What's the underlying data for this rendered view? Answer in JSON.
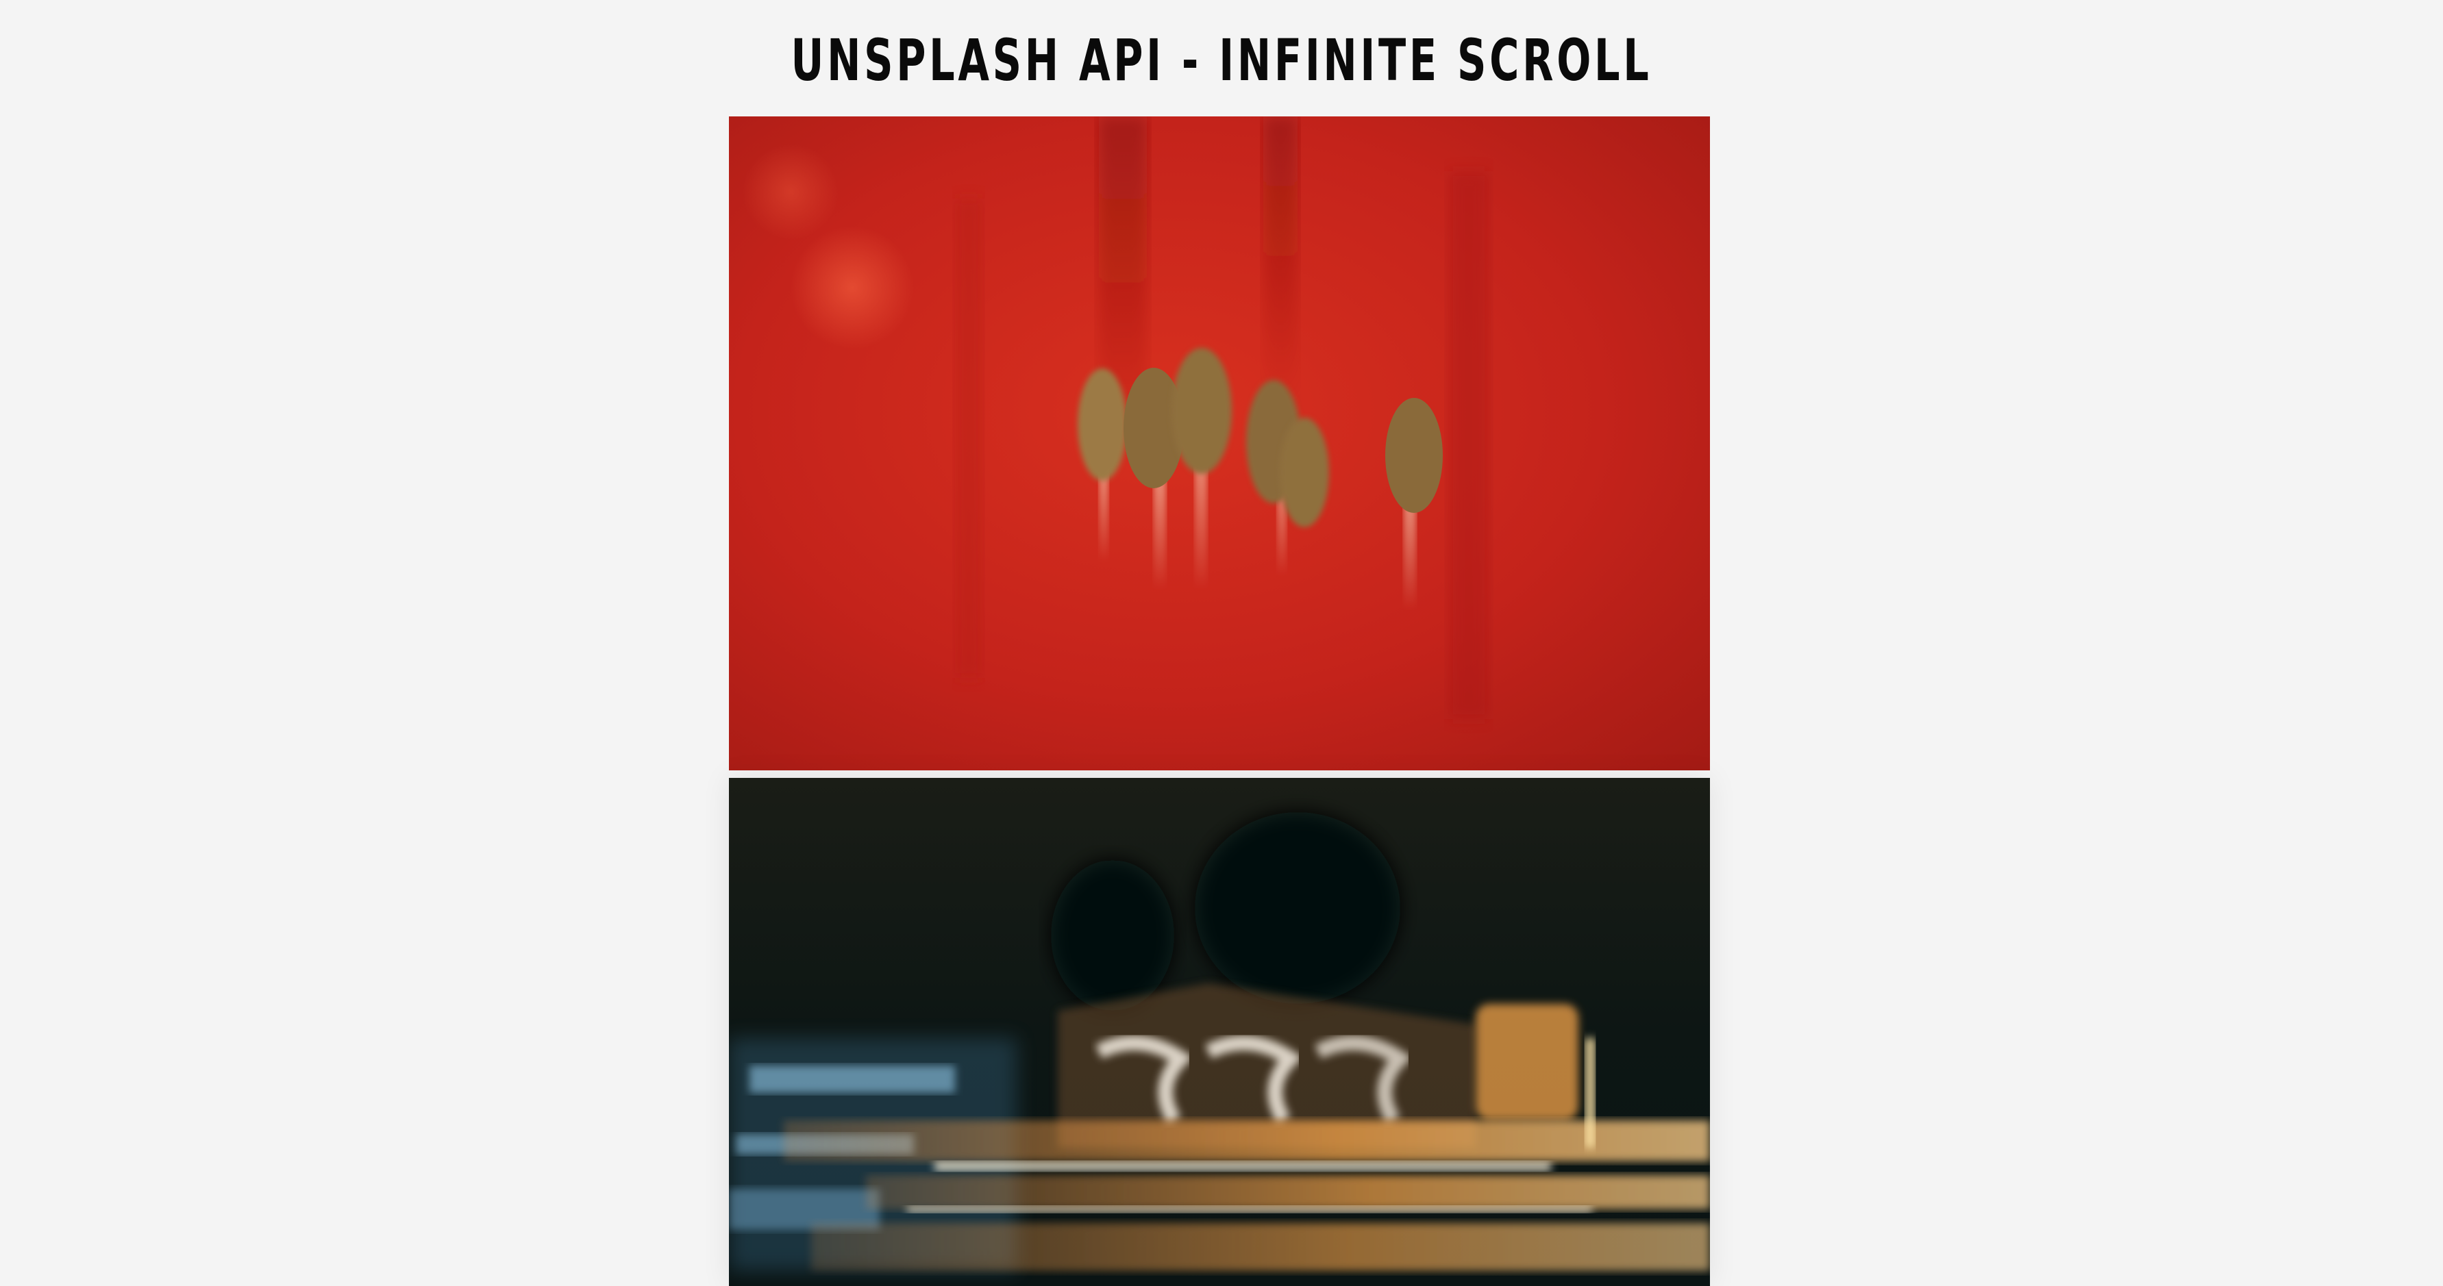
{
  "header": {
    "title": "UNSPLASH API - INFINITE SCROLL"
  },
  "images": [
    {
      "icon": "red-flower-stamens-photo",
      "colors": {
        "primary": "#d12a1f",
        "dark": "#9e1a15",
        "anther": "#8a6a3a"
      }
    },
    {
      "icon": "night-light-trails-photo",
      "colors": {
        "sky": "#0d1614",
        "warm": "#f2a24a",
        "cool": "#8fc6e6"
      }
    }
  ]
}
